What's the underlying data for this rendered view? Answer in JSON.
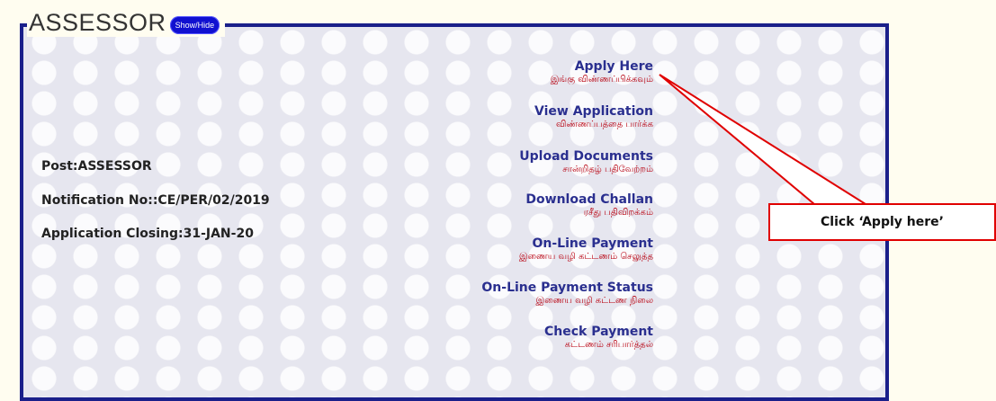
{
  "fieldset": {
    "title": "ASSESSOR",
    "toggle_label": "Show/Hide"
  },
  "info": {
    "post": "Post:ASSESSOR",
    "notification": "Notification No::CE/PER/02/2019",
    "closing": "Application Closing:31-JAN-20"
  },
  "links": [
    {
      "en": "Apply Here",
      "ta": "இங்கு விண்ணப்பிக்கவும்"
    },
    {
      "en": "View Application",
      "ta": "விண்ணப்பத்தை பார்க்க"
    },
    {
      "en": "Upload Documents",
      "ta": "சான்றிதழ் பதிவேற்றம்"
    },
    {
      "en": "Download Challan",
      "ta": "ரசீது பதிவிறக்கம்"
    },
    {
      "en": "On-Line Payment",
      "ta": "இணைய வழி கட்டணம் செலுத்த"
    },
    {
      "en": "On-Line Payment Status",
      "ta": "இணைய வழி கட்டண நிலை"
    },
    {
      "en": "Check Payment",
      "ta": "கட்டணம் சரிபார்த்தல்"
    }
  ],
  "callout": {
    "text": "Click ‘Apply here’"
  },
  "colors": {
    "border": "#1a1f8a",
    "link": "#2a2f8f",
    "tamil": "#b8000f",
    "callout_border": "#e00000",
    "toggle": "#1010d0"
  }
}
